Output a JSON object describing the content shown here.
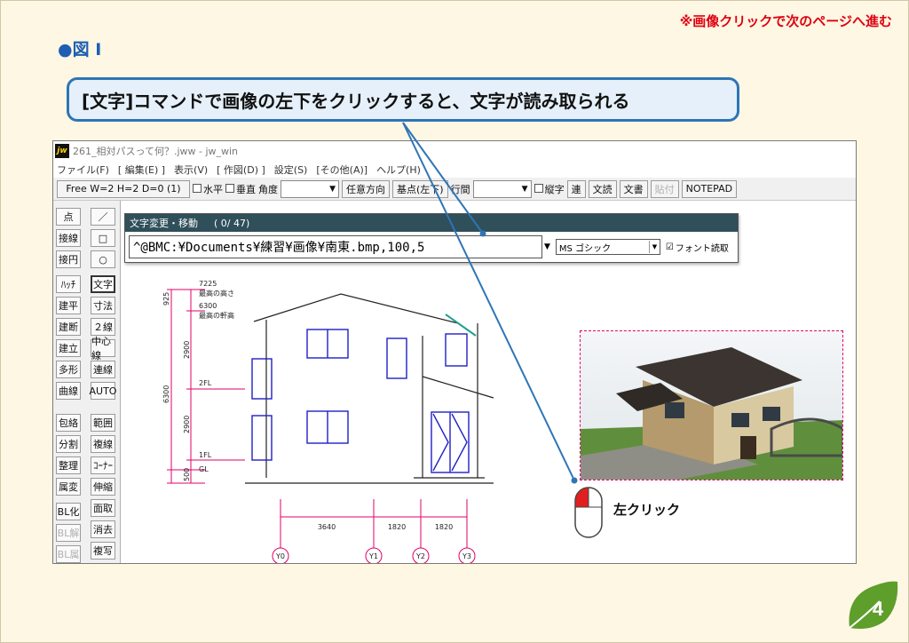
{
  "notice": "※画像クリックで次のページへ進む",
  "figure_title": "●図 I",
  "callout": "[文字]コマンドで画像の左下をクリックすると、文字が読み取られる",
  "window": {
    "icon": "jw",
    "title": "261_相対パスって何？.jww - jw_win",
    "menu": [
      "ファイル(F)",
      "[ 編集(E) ]",
      "表示(V)",
      "[ 作図(D) ]",
      "設定(S)",
      "[その他(A)]",
      "ヘルプ(H)"
    ]
  },
  "toolbar": {
    "mode": "Free W=2 H=2 D=0 (1)",
    "horizontal": "水平",
    "vertical": "垂直",
    "angle": "角度",
    "free_direction": "任意方向",
    "base_point": "基点(左下)",
    "line_spacing": "行間",
    "vertical_text": "縦字",
    "continuous": "連",
    "read_text": "文読",
    "write_text": "文書",
    "paste": "貼付",
    "notepad": "NOTEPAD"
  },
  "tools_left": [
    "点",
    "接線",
    "接円",
    "ﾊｯﾁ",
    "建平",
    "建断",
    "建立",
    "多形",
    "曲線",
    "包絡",
    "分割",
    "整理",
    "属変",
    "BL化",
    "BL解",
    "BL属"
  ],
  "tools_right": [
    "／",
    "□",
    "○",
    "文字",
    "寸法",
    "２線",
    "中心線",
    "連線",
    "AUTO",
    "範囲",
    "複線",
    "ｺｰﾅｰ",
    "伸縮",
    "面取",
    "消去",
    "複写"
  ],
  "dialog": {
    "title": "文字変更・移動",
    "count": "( 0/ 47)",
    "text_value": "^@BMC:¥Documents¥練習¥画像¥南東.bmp,100,5",
    "font": "MS ゴシック",
    "font_read": "フォント読取"
  },
  "drawing": {
    "levels": [
      "7225",
      "最高の高さ",
      "6300",
      "最高の軒高",
      "2FL",
      "1FL",
      "GL"
    ],
    "vertical_dims": [
      "925",
      "2900",
      "6300",
      "2900",
      "500"
    ],
    "horizontal_dims": [
      "3640",
      "1820",
      "1820"
    ],
    "grid_labels": [
      "Y0",
      "Y1",
      "Y2",
      "Y3"
    ]
  },
  "mouse_label": "左クリック",
  "page_number": "4",
  "colors": {
    "accent_blue": "#2e75b6",
    "notice_red": "#e00010",
    "drawing_blue": "#1f1fc8",
    "dimension_magenta": "#e0006a",
    "page_green": "#5e9e2b"
  }
}
